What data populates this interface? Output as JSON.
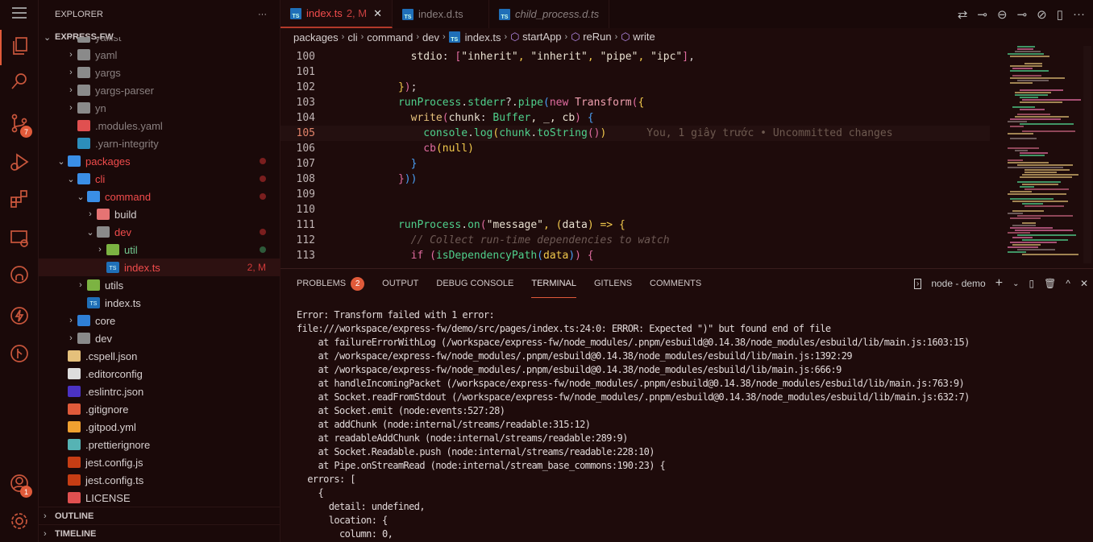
{
  "activity_bar": {
    "items": [
      {
        "icon": "menu-icon"
      },
      {
        "icon": "files-icon",
        "active": true
      },
      {
        "icon": "search-icon"
      },
      {
        "icon": "source-control-icon",
        "badge": "7"
      },
      {
        "icon": "run-debug-icon"
      },
      {
        "icon": "extensions-icon"
      },
      {
        "icon": "remote-explorer-icon"
      },
      {
        "icon": "github-icon"
      },
      {
        "icon": "lightning-icon"
      },
      {
        "icon": "git-graph-icon"
      }
    ],
    "account_badge": "1"
  },
  "sidebar": {
    "title": "EXPLORER",
    "more": "···",
    "root": "EXPRESS-FW",
    "items": [
      {
        "label": "yallist",
        "depth": 1,
        "twisty": ">",
        "icon": "folder",
        "color": "#8a8080"
      },
      {
        "label": "yaml",
        "depth": 1,
        "twisty": ">",
        "icon": "folder",
        "color": "#8a8080"
      },
      {
        "label": "yargs",
        "depth": 1,
        "twisty": ">",
        "icon": "folder",
        "color": "#8a8080"
      },
      {
        "label": "yargs-parser",
        "depth": 1,
        "twisty": ">",
        "icon": "folder",
        "color": "#8a8080"
      },
      {
        "label": "yn",
        "depth": 1,
        "twisty": ">",
        "icon": "folder",
        "color": "#8a8080"
      },
      {
        "label": ".modules.yaml",
        "depth": 1,
        "twisty": "",
        "icon": "yaml",
        "color": "#8a8080"
      },
      {
        "label": ".yarn-integrity",
        "depth": 1,
        "twisty": "",
        "icon": "yarn",
        "color": "#8a8080"
      },
      {
        "label": "packages",
        "depth": 0,
        "twisty": "v",
        "icon": "folder-packages",
        "color": "#f14c4c",
        "dot": "#7a1e1e"
      },
      {
        "label": "cli",
        "depth": 1,
        "twisty": "v",
        "icon": "folder-blue",
        "color": "#f14c4c",
        "dot": "#7a1e1e"
      },
      {
        "label": "command",
        "depth": 2,
        "twisty": "v",
        "icon": "folder-blue",
        "color": "#f14c4c",
        "dot": "#7a1e1e"
      },
      {
        "label": "build",
        "depth": 3,
        "twisty": ">",
        "icon": "folder-red",
        "color": "#d6cfcf"
      },
      {
        "label": "dev",
        "depth": 3,
        "twisty": "v",
        "icon": "folder",
        "color": "#f14c4c",
        "dot": "#7a1e1e"
      },
      {
        "label": "util",
        "depth": 4,
        "twisty": ">",
        "icon": "folder-green",
        "color": "#73c991",
        "dot": "#2e5a3a"
      },
      {
        "label": "index.ts",
        "depth": 4,
        "twisty": "",
        "icon": "ts",
        "color": "#f14c4c",
        "deco": "2, M",
        "selected": true
      },
      {
        "label": "utils",
        "depth": 2,
        "twisty": ">",
        "icon": "folder-green",
        "color": "#d6cfcf"
      },
      {
        "label": "index.ts",
        "depth": 2,
        "twisty": "",
        "icon": "ts",
        "color": "#d6cfcf"
      },
      {
        "label": "core",
        "depth": 1,
        "twisty": ">",
        "icon": "folder-core",
        "color": "#d6cfcf"
      },
      {
        "label": "dev",
        "depth": 1,
        "twisty": ">",
        "icon": "folder",
        "color": "#d6cfcf"
      },
      {
        "label": ".cspell.json",
        "depth": 0,
        "twisty": "",
        "icon": "json",
        "color": "#d6cfcf"
      },
      {
        "label": ".editorconfig",
        "depth": 0,
        "twisty": "",
        "icon": "editorconfig",
        "color": "#d6cfcf"
      },
      {
        "label": ".eslintrc.json",
        "depth": 0,
        "twisty": "",
        "icon": "eslint",
        "color": "#d6cfcf"
      },
      {
        "label": ".gitignore",
        "depth": 0,
        "twisty": "",
        "icon": "git",
        "color": "#d6cfcf"
      },
      {
        "label": ".gitpod.yml",
        "depth": 0,
        "twisty": "",
        "icon": "gitpod",
        "color": "#d6cfcf"
      },
      {
        "label": ".prettierignore",
        "depth": 0,
        "twisty": "",
        "icon": "prettier",
        "color": "#d6cfcf"
      },
      {
        "label": "jest.config.js",
        "depth": 0,
        "twisty": "",
        "icon": "jest",
        "color": "#d6cfcf"
      },
      {
        "label": "jest.config.ts",
        "depth": 0,
        "twisty": "",
        "icon": "jest",
        "color": "#d6cfcf"
      },
      {
        "label": "LICENSE",
        "depth": 0,
        "twisty": "",
        "icon": "license",
        "color": "#d6cfcf"
      }
    ],
    "sections": [
      "OUTLINE",
      "TIMELINE"
    ]
  },
  "editor": {
    "tabs": [
      {
        "label": "index.ts",
        "status": "2, M",
        "active": true
      },
      {
        "label": "index.d.ts"
      },
      {
        "label": "child_process.d.ts",
        "italic": true
      }
    ],
    "breadcrumbs": [
      "packages",
      "cli",
      "command",
      "dev",
      "index.ts",
      "startApp",
      "reRun",
      "write"
    ],
    "current_line": 105,
    "blame": "You, 1 giây trước • Uncommitted changes",
    "lines": [
      {
        "n": "100",
        "indent": "        ",
        "tokens": [
          [
            "stdio",
            "t-prop"
          ],
          [
            ": ",
            "t-p"
          ],
          [
            "[",
            "t-br2"
          ],
          [
            "\"inherit\"",
            "t-str"
          ],
          [
            ", ",
            "t-var"
          ],
          [
            "\"inherit\"",
            "t-str"
          ],
          [
            ", ",
            "t-var"
          ],
          [
            "\"pipe\"",
            "t-str"
          ],
          [
            ", ",
            "t-var"
          ],
          [
            "\"ipc\"",
            "t-str"
          ],
          [
            "]",
            "t-br2"
          ],
          [
            ",",
            "t-p"
          ]
        ]
      },
      {
        "n": "101",
        "indent": "",
        "tokens": []
      },
      {
        "n": "102",
        "indent": "      ",
        "tokens": [
          [
            "}",
            "t-br1"
          ],
          [
            ")",
            "t-br2"
          ],
          [
            ";",
            "t-p"
          ]
        ]
      },
      {
        "n": "103",
        "indent": "      ",
        "tokens": [
          [
            "runProcess",
            "t-id"
          ],
          [
            ".",
            "t-p"
          ],
          [
            "stderr",
            "t-id"
          ],
          [
            "?.",
            "t-p"
          ],
          [
            "pipe",
            "t-id"
          ],
          [
            "(",
            "t-br3"
          ],
          [
            "new ",
            "t-kw"
          ],
          [
            "Transform",
            "t-cls"
          ],
          [
            "(",
            "t-br2"
          ],
          [
            "{",
            "t-br1"
          ]
        ]
      },
      {
        "n": "104",
        "indent": "        ",
        "tokens": [
          [
            "write",
            "t-fn"
          ],
          [
            "(",
            "t-br2"
          ],
          [
            "chunk",
            "t-prop"
          ],
          [
            ": ",
            "t-p"
          ],
          [
            "Buffer",
            "t-ty"
          ],
          [
            ", _, cb",
            "t-prop"
          ],
          [
            ")",
            "t-br2"
          ],
          [
            " ",
            "t-p"
          ],
          [
            "{",
            "t-br3"
          ]
        ]
      },
      {
        "n": "105",
        "indent": "          ",
        "tokens": [
          [
            "console",
            "t-id"
          ],
          [
            ".",
            "t-p"
          ],
          [
            "log",
            "t-id"
          ],
          [
            "(",
            "t-br1"
          ],
          [
            "chunk",
            "t-id"
          ],
          [
            ".",
            "t-p"
          ],
          [
            "toString",
            "t-id"
          ],
          [
            "()",
            "t-br2"
          ],
          [
            ")",
            "t-br1"
          ]
        ]
      },
      {
        "n": "106",
        "indent": "          ",
        "tokens": [
          [
            "cb",
            "t-kw"
          ],
          [
            "(",
            "t-br1"
          ],
          [
            "null",
            "t-var"
          ],
          [
            ")",
            "t-br1"
          ]
        ]
      },
      {
        "n": "107",
        "indent": "        ",
        "tokens": [
          [
            "}",
            "t-br3"
          ]
        ]
      },
      {
        "n": "108",
        "indent": "      ",
        "tokens": [
          [
            "}",
            "t-br2"
          ],
          [
            ")",
            "t-br3"
          ],
          [
            ")",
            "t-br3"
          ]
        ]
      },
      {
        "n": "109",
        "indent": "",
        "tokens": []
      },
      {
        "n": "110",
        "indent": "",
        "tokens": []
      },
      {
        "n": "111",
        "indent": "      ",
        "tokens": [
          [
            "runProcess",
            "t-id"
          ],
          [
            ".",
            "t-p"
          ],
          [
            "on",
            "t-id"
          ],
          [
            "(",
            "t-br2"
          ],
          [
            "\"message\"",
            "t-str"
          ],
          [
            ", ",
            "t-var"
          ],
          [
            "(",
            "t-br1"
          ],
          [
            "data",
            "t-prop"
          ],
          [
            ")",
            "t-br1"
          ],
          [
            " => ",
            "t-var"
          ],
          [
            "{",
            "t-br1"
          ]
        ]
      },
      {
        "n": "112",
        "indent": "        ",
        "tokens": [
          [
            "// Collect run-time dependencies to watch",
            "t-cm"
          ]
        ]
      },
      {
        "n": "113",
        "indent": "        ",
        "tokens": [
          [
            "if ",
            "t-kw"
          ],
          [
            "(",
            "t-br2"
          ],
          [
            "isDependencyPath",
            "t-id"
          ],
          [
            "(",
            "t-br3"
          ],
          [
            "data",
            "t-var"
          ],
          [
            ")",
            "t-br3"
          ],
          [
            ")",
            "t-br2"
          ],
          [
            " ",
            "t-p"
          ],
          [
            "{",
            "t-br2"
          ]
        ]
      }
    ]
  },
  "panel": {
    "tabs": [
      {
        "label": "PROBLEMS",
        "badge": "2"
      },
      {
        "label": "OUTPUT"
      },
      {
        "label": "DEBUG CONSOLE"
      },
      {
        "label": "TERMINAL",
        "active": true
      },
      {
        "label": "GITLENS"
      },
      {
        "label": "COMMENTS"
      }
    ],
    "terminal_name": "node - demo",
    "terminal_lines": [
      "Error: Transform failed with 1 error:",
      "file:///workspace/express-fw/demo/src/pages/index.ts:24:0: ERROR: Expected \")\" but found end of file",
      "    at failureErrorWithLog (/workspace/express-fw/node_modules/.pnpm/esbuild@0.14.38/node_modules/esbuild/lib/main.js:1603:15)",
      "    at /workspace/express-fw/node_modules/.pnpm/esbuild@0.14.38/node_modules/esbuild/lib/main.js:1392:29",
      "    at /workspace/express-fw/node_modules/.pnpm/esbuild@0.14.38/node_modules/esbuild/lib/main.js:666:9",
      "    at handleIncomingPacket (/workspace/express-fw/node_modules/.pnpm/esbuild@0.14.38/node_modules/esbuild/lib/main.js:763:9)",
      "    at Socket.readFromStdout (/workspace/express-fw/node_modules/.pnpm/esbuild@0.14.38/node_modules/esbuild/lib/main.js:632:7)",
      "    at Socket.emit (node:events:527:28)",
      "    at addChunk (node:internal/streams/readable:315:12)",
      "    at readableAddChunk (node:internal/streams/readable:289:9)",
      "    at Socket.Readable.push (node:internal/streams/readable:228:10)",
      "    at Pipe.onStreamRead (node:internal/stream_base_commons:190:23) {",
      "  errors: [",
      "    {",
      "      detail: undefined,",
      "      location: {",
      "        column: 0,"
    ]
  },
  "colors": {
    "accent": "#e05a3a",
    "modified": "#f14c4c",
    "background": "#1e0b0b"
  }
}
